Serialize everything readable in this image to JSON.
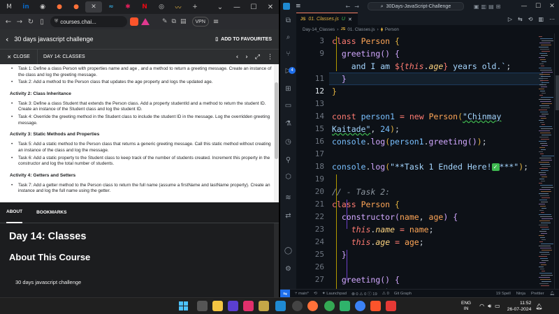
{
  "browser": {
    "tab_icons": [
      "M",
      "in",
      "gh-icon",
      "firefox-icon",
      "firefox-icon",
      "udemy-close",
      "tailwind-icon",
      "slack-icon",
      "netflix-icon",
      "github-icon",
      "wavy-icon",
      "new-tab-plus"
    ],
    "address": {
      "url": "courses.chai...",
      "vpn_label": "VPN"
    },
    "course_title": "30 days javascript challenge",
    "favourites_label": "ADD TO FAVOURITES",
    "lecture_bar": {
      "close_label": "CLOSE",
      "day_label": "DAY 14: CLASSES"
    },
    "lesson": {
      "task1": "Task 1: Define a class Person with properties name and age , and a method to return a greeting message. Create an instance of the class and log the greeting message.",
      "task2": "Task 2: Add a method to the Person class that updates the age property and logs the updated age.",
      "activity2": "Activity 2: Class Inheritance",
      "task3": "Task 3: Define a class Student that extends the Person class. Add a property studentId and a method to return the student ID. Create an instance of the Student class and log the student ID.",
      "task4": "Task 4: Override the greeting method in the Student class to include the student ID in the message. Log the overridden greeting message.",
      "activity3": "Activity 3: Static Methods and Properties",
      "task5": "Task 5: Add a static method to the Person class that returns a generic greeting message. Call this static method without creating an instance of the class and log the message.",
      "task6": "Task 6: Add a static property to the Student class to keep track of the number of students created. Increment this property in the constructor and log the total number of students.",
      "activity4": "Activity 4: Getters and Setters",
      "task7": "Task 7: Add a getter method to the Person class to return the full name (assume a firstName and lastName property). Create an instance and log the full name using the getter."
    },
    "about_tabs": [
      "ABOUT",
      "BOOKMARKS"
    ],
    "about": {
      "heading": "Day 14: Classes",
      "subheading": "About This Course",
      "course_name": "30 days javascript challenge"
    }
  },
  "vscode": {
    "search_text": "30Days-JavaScript-Challenge",
    "tab": {
      "lang": "JS",
      "name": "01. Classes.js",
      "status": "U"
    },
    "breadcrumb": [
      "Day-14_Classes",
      "01. Classes.js",
      "Person"
    ],
    "line_numbers": [
      "3",
      "9",
      "",
      "11",
      "12",
      "13",
      "14",
      "15",
      "16",
      "17",
      "18",
      "19",
      "20",
      "21",
      "22",
      "23",
      "24",
      "25",
      "26",
      "27",
      "",
      "28",
      "29"
    ],
    "statusbar": {
      "branch": "main*",
      "sync": "⊗ 0 ⚠ 0",
      "launchpad": "Launchpad",
      "problems": "⊗ 0 ⚠ 0 ⓘ 19",
      "warn": "⚠ 0",
      "git_graph": "Git Graph",
      "spell": "19 Spell",
      "ninja": "Ninja",
      "prettier": "Prettier"
    }
  },
  "taskbar": {
    "lang_top": "ENG",
    "lang_bottom": "IN",
    "time": "11:52",
    "date": "26-07-2024"
  }
}
